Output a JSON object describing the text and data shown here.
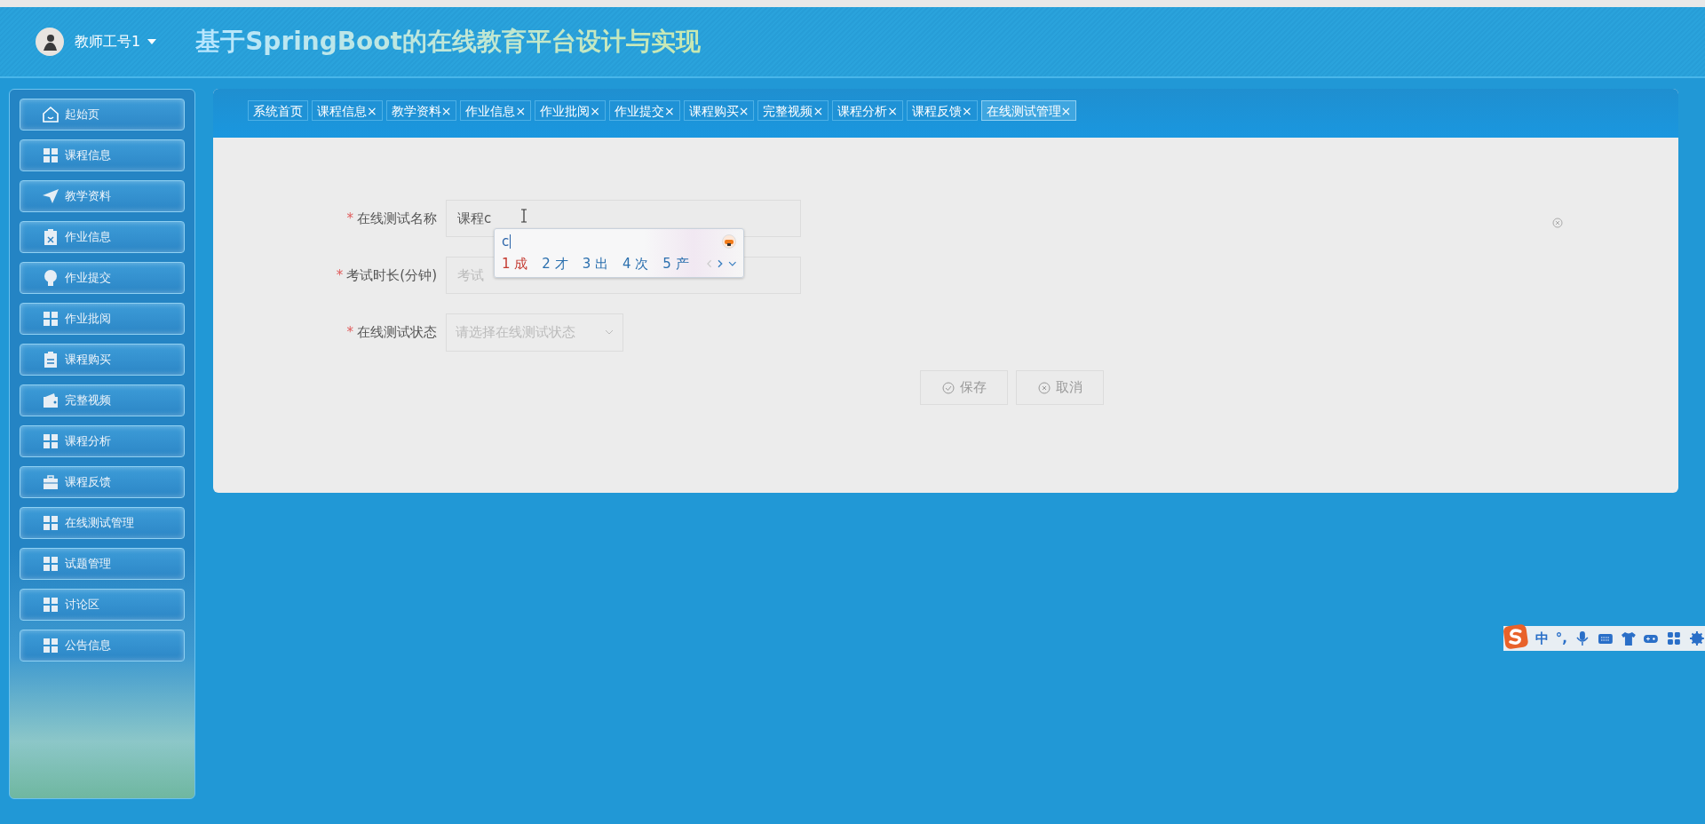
{
  "header": {
    "user": "教师工号1",
    "title": "基于SpringBoot的在线教育平台设计与实现"
  },
  "sidebar": {
    "items": [
      {
        "label": "起始页",
        "kind": "home"
      },
      {
        "label": "课程信息",
        "kind": "grid"
      },
      {
        "label": "教学资料",
        "kind": "plane"
      },
      {
        "label": "作业信息",
        "kind": "clipx"
      },
      {
        "label": "作业提交",
        "kind": "bulb"
      },
      {
        "label": "作业批阅",
        "kind": "grid"
      },
      {
        "label": "课程购买",
        "kind": "clip"
      },
      {
        "label": "完整视频",
        "kind": "wallet"
      },
      {
        "label": "课程分析",
        "kind": "grid"
      },
      {
        "label": "课程反馈",
        "kind": "case"
      },
      {
        "label": "在线测试管理",
        "kind": "grid"
      },
      {
        "label": "试题管理",
        "kind": "grid"
      },
      {
        "label": "讨论区",
        "kind": "grid"
      },
      {
        "label": "公告信息",
        "kind": "grid"
      }
    ]
  },
  "tabs": [
    {
      "label": "系统首页",
      "selected": false
    },
    {
      "label": "课程信息",
      "close": "×",
      "selected": false
    },
    {
      "label": "教学资料",
      "close": "×",
      "selected": false
    },
    {
      "label": "作业信息",
      "close": "×",
      "selected": false
    },
    {
      "label": "作业批阅",
      "close": "×",
      "selected": false
    },
    {
      "label": "作业提交",
      "close": "×",
      "selected": false
    },
    {
      "label": "课程购买",
      "close": "×",
      "selected": false
    },
    {
      "label": "完整视频",
      "close": "×",
      "selected": false
    },
    {
      "label": "课程分析",
      "close": "×",
      "selected": false
    },
    {
      "label": "课程反馈",
      "close": "×",
      "selected": false
    },
    {
      "label": "在线测试管理",
      "close": "×",
      "selected": true
    }
  ],
  "form": {
    "fields": [
      {
        "kind": "text",
        "required_mark": "*",
        "label": "在线测试名称",
        "value": "课程c"
      },
      {
        "kind": "text",
        "required_mark": "*",
        "label": "考试时长(分钟)",
        "placeholder": "考试"
      },
      {
        "kind": "select",
        "required_mark": "*",
        "label": "在线测试状态",
        "placeholder": "请选择在线测试状态"
      }
    ],
    "buttons": [
      {
        "label": "保存",
        "kind": "save"
      },
      {
        "label": "取消",
        "kind": "cancel"
      }
    ]
  },
  "ime_popup": {
    "composition": "c",
    "candidates": [
      {
        "number": "1",
        "text": "成",
        "selected": true
      },
      {
        "number": "2",
        "text": "才",
        "selected": false
      },
      {
        "number": "3",
        "text": "出",
        "selected": false
      },
      {
        "number": "4",
        "text": "次",
        "selected": false
      },
      {
        "number": "5",
        "text": "产",
        "selected": false
      }
    ]
  },
  "ime_toolbar": {
    "mode": "中",
    "punctuation": "°,"
  }
}
